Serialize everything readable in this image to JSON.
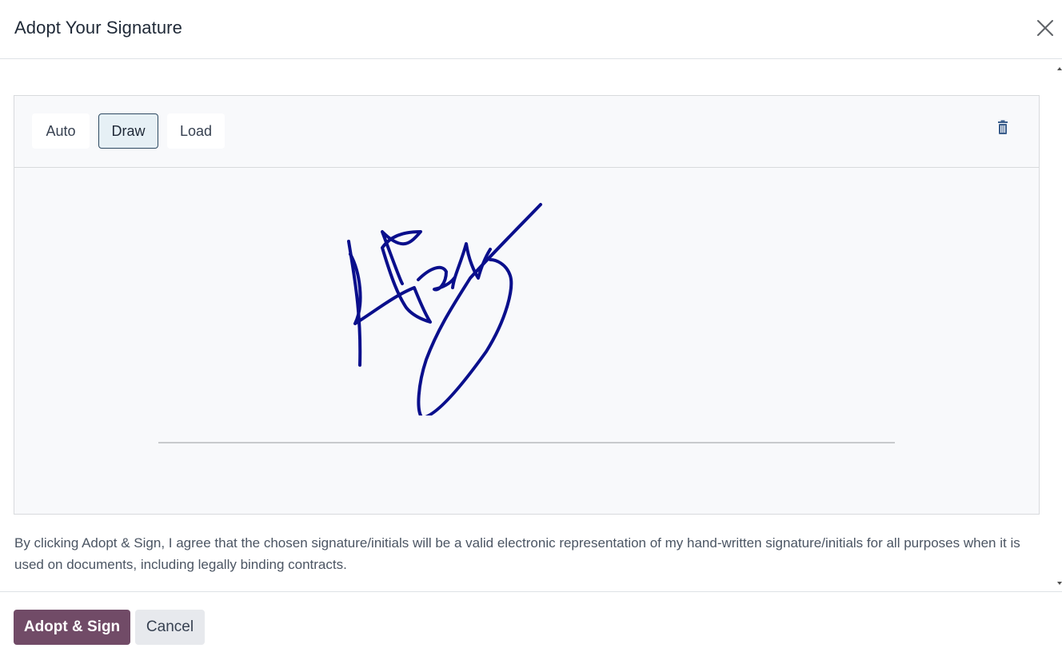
{
  "dialog": {
    "title": "Adopt Your Signature",
    "close_icon": "close-icon"
  },
  "signature": {
    "modes": [
      {
        "label": "Auto",
        "active": false
      },
      {
        "label": "Draw",
        "active": true
      },
      {
        "label": "Load",
        "active": false
      }
    ],
    "clear_icon": "trash-icon",
    "ink_color": "#0a0f8c"
  },
  "consent_text": "By clicking Adopt & Sign, I agree that the chosen signature/initials will be a valid electronic representation of my hand-written signature/initials for all purposes when it is used on documents, including legally binding contracts.",
  "footer": {
    "primary_label": "Adopt & Sign",
    "secondary_label": "Cancel"
  },
  "colors": {
    "primary": "#714b67",
    "active_mode_bg": "#e6f0f5",
    "active_mode_border": "#2e4a62"
  }
}
